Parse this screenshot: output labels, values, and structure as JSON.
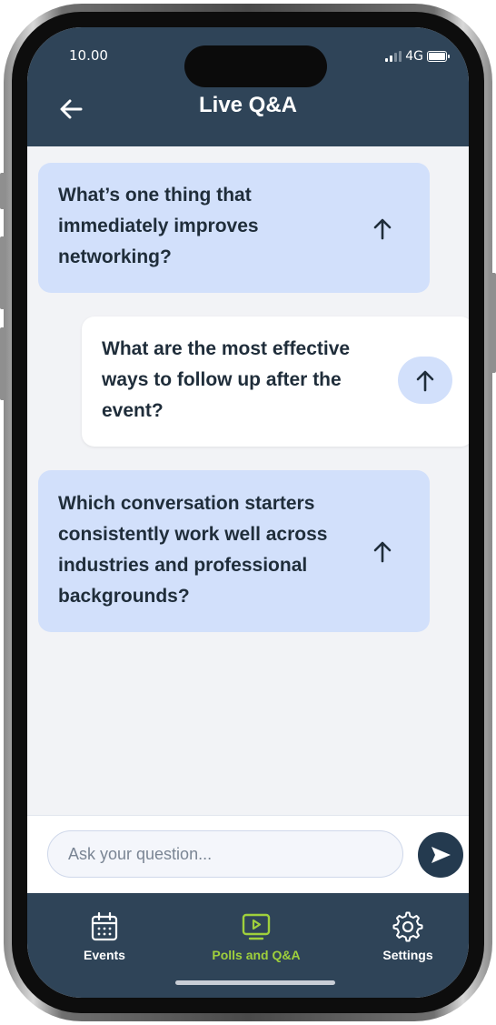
{
  "status_bar": {
    "time": "10.00",
    "network": "4G"
  },
  "header": {
    "title": "Live Q&A",
    "back_icon": "arrow-left-icon"
  },
  "questions": [
    {
      "text": "What’s one thing that immediately improves networking?",
      "style": "blue"
    },
    {
      "text": "What are the most effective ways to follow up after the event?",
      "style": "white"
    },
    {
      "text": "Which conversation starters consistently work well across industries and professional backgrounds?",
      "style": "blue"
    }
  ],
  "composer": {
    "placeholder": "Ask your question...",
    "send_icon": "send-icon"
  },
  "tabs": [
    {
      "label": "Events",
      "icon": "calendar-icon",
      "active": false
    },
    {
      "label": "Polls and Q&A",
      "icon": "play-screen-icon",
      "active": true
    },
    {
      "label": "Settings",
      "icon": "gear-icon",
      "active": false
    }
  ],
  "colors": {
    "header_bg": "#2f4458",
    "card_blue": "#d2e0fb",
    "card_white": "#ffffff",
    "active_tab": "#9fd03c",
    "send_button": "#243a4f"
  }
}
